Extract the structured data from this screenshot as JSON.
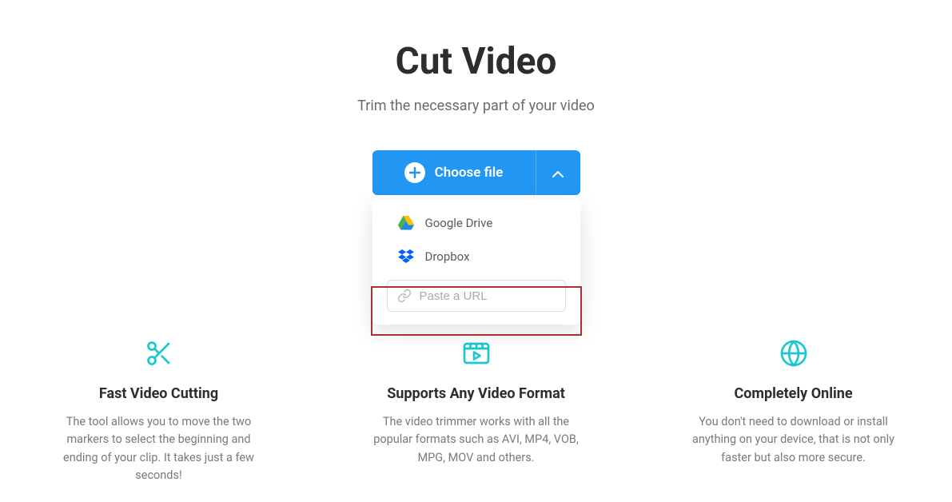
{
  "header": {
    "title": "Cut Video",
    "subtitle": "Trim the necessary part of your video"
  },
  "upload": {
    "button_label": "Choose file",
    "dropdown": {
      "google_drive": "Google Drive",
      "dropbox": "Dropbox",
      "url_placeholder": "Paste a URL"
    }
  },
  "features": [
    {
      "title": "Fast Video Cutting",
      "desc": "The tool allows you to move the two markers to select the beginning and ending of your clip. It takes just a few seconds!"
    },
    {
      "title": "Supports Any Video Format",
      "desc": "The video trimmer works with all the popular formats such as AVI, MP4, VOB, MPG, MOV and others."
    },
    {
      "title": "Completely Online",
      "desc": "You don't need to download or install anything on your device, that is not only faster but also more secure."
    }
  ]
}
